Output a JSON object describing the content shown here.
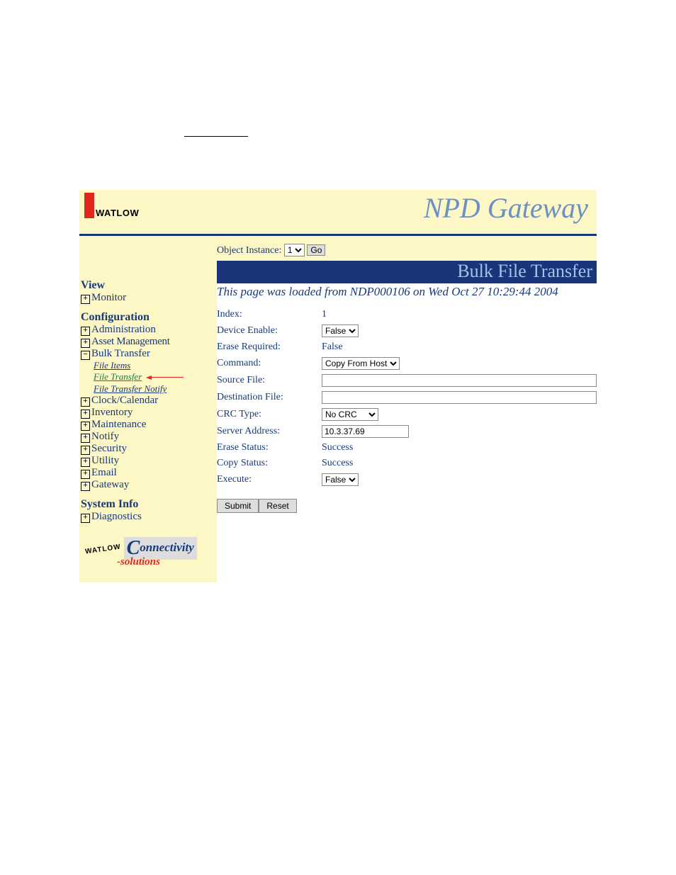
{
  "header": {
    "logo_text": "WATLOW",
    "title": "NPD Gateway"
  },
  "instance": {
    "label": "Object Instance:",
    "value": "1",
    "go": "Go"
  },
  "page_title": "Bulk File Transfer",
  "loaded_msg": "This page was loaded from NDP000106 on Wed Oct 27 10:29:44 2004",
  "sidebar": {
    "view": "View",
    "monitor": "Monitor",
    "config": "Configuration",
    "admin": "Administration",
    "asset": "Asset Management",
    "bulk": "Bulk Transfer",
    "sub_file_items": "File Items",
    "sub_file_transfer": "File Transfer",
    "sub_file_transfer_notify": "File Transfer Notify",
    "clock": "Clock/Calendar",
    "inventory": "Inventory",
    "maintenance": "Maintenance",
    "notify": "Notify",
    "security": "Security",
    "utility": "Utility",
    "email": "Email",
    "gateway": "Gateway",
    "sysinfo": "System Info",
    "diag": "Diagnostics"
  },
  "cs_logo": {
    "arc": "WATLOW",
    "connectivity": "onnectivity",
    "solutions": "-solutions"
  },
  "form": {
    "index": {
      "label": "Index:",
      "value": "1"
    },
    "device_enable": {
      "label": "Device Enable:",
      "value": "False"
    },
    "erase_required": {
      "label": "Erase Required:",
      "value": "False"
    },
    "command": {
      "label": "Command:",
      "value": "Copy From Host"
    },
    "source_file": {
      "label": "Source File:",
      "value": ""
    },
    "destination_file": {
      "label": "Destination File:",
      "value": ""
    },
    "crc_type": {
      "label": "CRC Type:",
      "value": "No CRC"
    },
    "server_address": {
      "label": "Server Address:",
      "value": "10.3.37.69"
    },
    "erase_status": {
      "label": "Erase Status:",
      "value": "Success"
    },
    "copy_status": {
      "label": "Copy Status:",
      "value": "Success"
    },
    "execute": {
      "label": "Execute:",
      "value": "False"
    }
  },
  "buttons": {
    "submit": "Submit",
    "reset": "Reset"
  }
}
